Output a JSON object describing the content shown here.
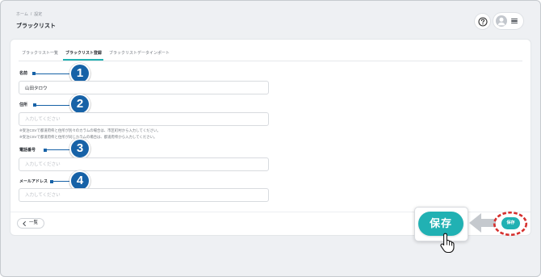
{
  "breadcrumb": {
    "home": "ホーム",
    "separator": "/",
    "current": "設定"
  },
  "page": {
    "title": "ブラックリスト"
  },
  "header": {
    "help_icon": "question-circle-icon",
    "avatar_icon": "user-icon",
    "menu_icon": "menu-icon"
  },
  "tabs": [
    {
      "label": "ブラックリスト一覧",
      "active": false
    },
    {
      "label": "ブラックリスト登録",
      "active": true
    },
    {
      "label": "ブラックリストデータインポート",
      "active": false
    }
  ],
  "form": {
    "fields": [
      {
        "label": "名前",
        "value": "山田タロウ"
      },
      {
        "label": "住所",
        "placeholder": "入力してください",
        "notes": [
          "※受注CSVで都道府県と住所が別々のカラムの場合は、市区町村から入力してください。",
          "※受注CSVで都道府県と住所が同じカラムの場合は、都道府県から入力してください。"
        ]
      },
      {
        "label": "電話番号",
        "placeholder": "入力してください"
      },
      {
        "label": "メールアドレス",
        "placeholder": "入力してください"
      }
    ]
  },
  "footer": {
    "back_icon": "chevron-left-icon",
    "back_label": "一覧",
    "save_label": "保存"
  },
  "annotations": {
    "markers": [
      "1",
      "2",
      "3",
      "4"
    ],
    "zoomed_save_label": "保存",
    "cursor_icon": "hand-pointer-icon",
    "arrow_icon": "arrow-left-icon"
  },
  "colors": {
    "teal": "#21b1b3",
    "marker_blue": "#1762a7",
    "highlight_red": "#d6312f",
    "arrow_gray": "#c5c9ce"
  }
}
